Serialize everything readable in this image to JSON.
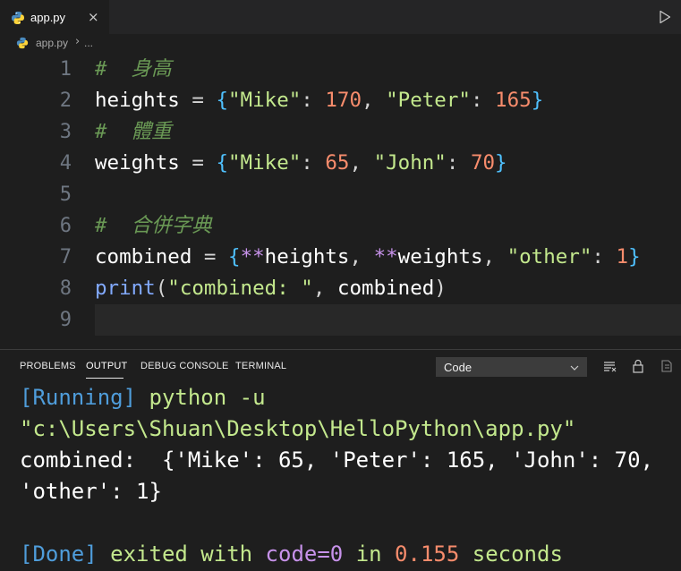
{
  "tabbar": {
    "active_tab_label": "app.py",
    "close_glyph": "×"
  },
  "breadcrumb": {
    "file": "app.py",
    "separator": "›",
    "more": "..."
  },
  "editor": {
    "line_numbers": [
      "1",
      "2",
      "3",
      "4",
      "5",
      "6",
      "7",
      "8",
      "9"
    ],
    "lines": {
      "l1": {
        "comment": "#  身高"
      },
      "l2": {
        "var": "heights",
        "op": " = ",
        "brace_open": "{",
        "s1": "\"Mike\"",
        "c1": ": ",
        "n1": "170",
        "sep1": ", ",
        "s2": "\"Peter\"",
        "c2": ": ",
        "n2": "165",
        "brace_close": "}"
      },
      "l3": {
        "comment": "#  體重"
      },
      "l4": {
        "var": "weights",
        "op": " = ",
        "brace_open": "{",
        "s1": "\"Mike\"",
        "c1": ": ",
        "n1": "65",
        "sep1": ", ",
        "s2": "\"John\"",
        "c2": ": ",
        "n2": "70",
        "brace_close": "}"
      },
      "l6": {
        "comment": "#  合併字典"
      },
      "l7": {
        "var": "combined",
        "op": " = ",
        "brace_open": "{",
        "sp1": "**",
        "a1": "heights",
        "sep1": ", ",
        "sp2": "**",
        "a2": "weights",
        "sep2": ", ",
        "s1": "\"other\"",
        "c1": ": ",
        "n1": "1",
        "brace_close": "}"
      },
      "l8": {
        "fn": "print",
        "paren_open": "(",
        "s1": "\"combined: \"",
        "sep1": ", ",
        "a1": "combined",
        "paren_close": ")"
      }
    }
  },
  "panel": {
    "tabs": [
      "PROBLEMS",
      "OUTPUT",
      "DEBUG CONSOLE",
      "TERMINAL"
    ],
    "active_tab": "OUTPUT",
    "channel_select": "Code",
    "output": {
      "running_tag": "[Running]",
      "running_cmd": " python -u",
      "path_line": "\"c:\\Users\\Shuan\\Desktop\\HelloPython\\app.py\"",
      "result_line1": "combined:  {'Mike': 65, 'Peter': 165, 'John': 70,",
      "result_line2": "'other': 1}",
      "done_tag": "[Done]",
      "done_text1": " exited with ",
      "done_code": "code=0",
      "done_text2": " in ",
      "done_time": "0.155",
      "done_text3": " seconds"
    }
  },
  "colors": {
    "background": "#1e1e1e",
    "comment": "#6a9955",
    "string": "#c3e88d",
    "number": "#f78c6c",
    "spread": "#c792ea",
    "function": "#82aaff",
    "brace": "#4fc1ff",
    "output_tag": "#4f9ddb"
  }
}
